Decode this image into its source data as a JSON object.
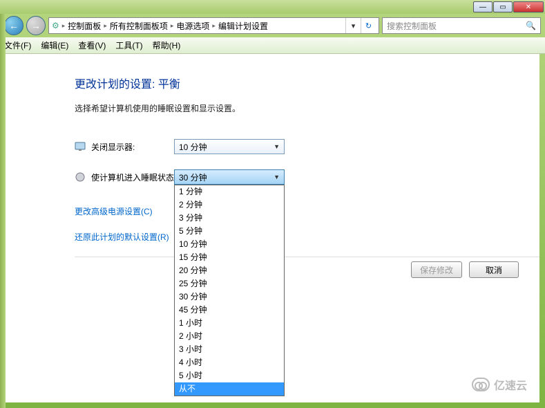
{
  "window": {
    "min_glyph": "—",
    "max_glyph": "▭",
    "close_glyph": "✕"
  },
  "nav": {
    "back_glyph": "←",
    "fwd_glyph": "→",
    "crumbs": [
      "控制面板",
      "所有控制面板项",
      "电源选项",
      "编辑计划设置"
    ],
    "sep": "▸",
    "drop_glyph": "▾",
    "refresh_glyph": "↻"
  },
  "search": {
    "placeholder": "搜索控制面板",
    "icon_glyph": "🔍"
  },
  "menu": {
    "items": [
      "文件(F)",
      "编辑(E)",
      "查看(V)",
      "工具(T)",
      "帮助(H)"
    ]
  },
  "page": {
    "title": "更改计划的设置: 平衡",
    "desc": "选择希望计算机使用的睡眠设置和显示设置。"
  },
  "settings": {
    "display_off": {
      "label": "关闭显示器:",
      "value": "10 分钟"
    },
    "sleep": {
      "label": "使计算机进入睡眠状态:",
      "value": "30 分钟"
    }
  },
  "dropdown_options": [
    "1 分钟",
    "2 分钟",
    "3 分钟",
    "5 分钟",
    "10 分钟",
    "15 分钟",
    "20 分钟",
    "25 分钟",
    "30 分钟",
    "45 分钟",
    "1 小时",
    "2 小时",
    "3 小时",
    "4 小时",
    "5 小时",
    "从不"
  ],
  "dropdown_highlight": "从不",
  "links": {
    "advanced": "更改高级电源设置(C)",
    "restore": "还原此计划的默认设置(R)"
  },
  "buttons": {
    "save": "保存修改",
    "cancel": "取消"
  },
  "watermark": "亿速云"
}
